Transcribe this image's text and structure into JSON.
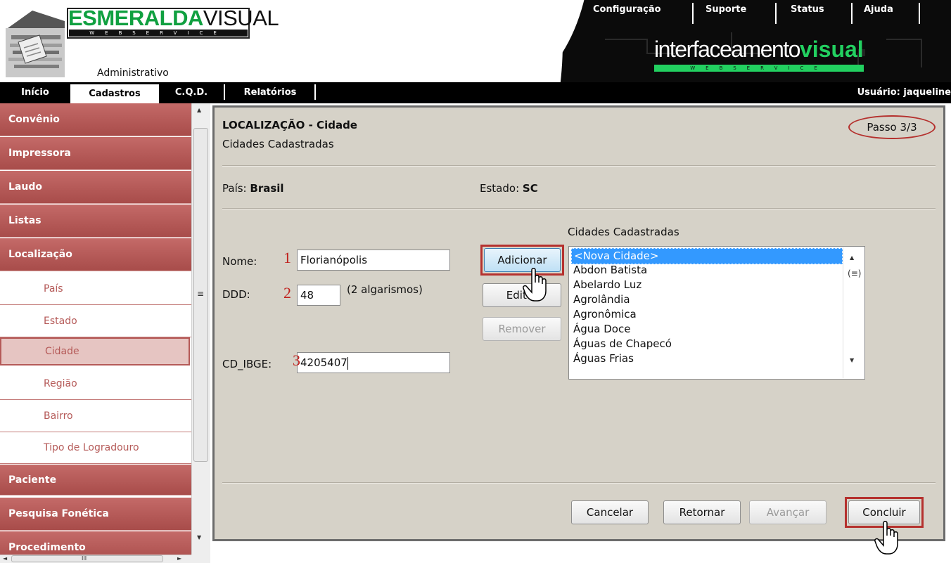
{
  "header": {
    "brand_part1": "ESMERALDA",
    "brand_part2": "VISUAL",
    "brand_sub": "WEBSERVICE",
    "admin_label": "Administrativo",
    "top_links": [
      "Configuração",
      "Suporte",
      "Status",
      "Ajuda"
    ],
    "iv_light": "interfaceamento",
    "iv_bold": "visual",
    "iv_sub": "WEBSERVICE"
  },
  "nav": {
    "items": [
      "Início",
      "Cadastros",
      "C.Q.D.",
      "Relatórios"
    ],
    "active": "Cadastros",
    "user": "Usuário: jaqueline"
  },
  "sidebar": {
    "items": [
      {
        "label": "Convênio",
        "type": "main"
      },
      {
        "label": "Impressora",
        "type": "main"
      },
      {
        "label": "Laudo",
        "type": "main"
      },
      {
        "label": "Listas",
        "type": "main"
      },
      {
        "label": "Localização",
        "type": "main"
      },
      {
        "label": "País",
        "type": "sub"
      },
      {
        "label": "Estado",
        "type": "sub"
      },
      {
        "label": "Cidade",
        "type": "sub",
        "active": true
      },
      {
        "label": "Região",
        "type": "sub"
      },
      {
        "label": "Bairro",
        "type": "sub"
      },
      {
        "label": "Tipo de Logradouro",
        "type": "sub"
      },
      {
        "label": "Paciente",
        "type": "main"
      },
      {
        "label": "Pesquisa Fonética",
        "type": "main"
      },
      {
        "label": "Procedimento",
        "type": "main"
      }
    ],
    "scroll_arrows": {
      "up": "▲",
      "down": "▼",
      "left": "◄",
      "right": "►",
      "grip": "≡",
      "hgrip": "III"
    }
  },
  "main": {
    "title": "LOCALIZAÇÃO - Cidade",
    "subtitle": "Cidades Cadastradas",
    "step": "Passo 3/3",
    "pais_label": "País:",
    "pais_value": "Brasil",
    "estado_label": "Estado:",
    "estado_value": "SC",
    "nome_label": "Nome:",
    "nome_value": "Florianópolis",
    "ddd_label": "DDD:",
    "ddd_value": "48",
    "ddd_hint": "(2 algarismos)",
    "ibge_label": "CD_IBGE:",
    "ibge_value": "4205407",
    "step_numbers": [
      "1",
      "2",
      "3"
    ],
    "list_label": "Cidades Cadastradas",
    "cities": [
      "<Nova Cidade>",
      "Abdon Batista",
      "Abelardo Luz",
      "Agrolândia",
      "Agronômica",
      "Água Doce",
      "Águas de Chapecó",
      "Águas Frias"
    ],
    "buttons": {
      "adicionar": "Adicionar",
      "editar": "Editar",
      "remover": "Remover",
      "cancelar": "Cancelar",
      "retornar": "Retornar",
      "avancar": "Avançar",
      "concluir": "Concluir"
    }
  },
  "colors": {
    "sidebar_main": "#b55a58",
    "highlight_red": "#b5312e",
    "panel_bg": "#d6d2c8",
    "selection_blue": "#3399ff",
    "brand_green": "#10a040"
  }
}
